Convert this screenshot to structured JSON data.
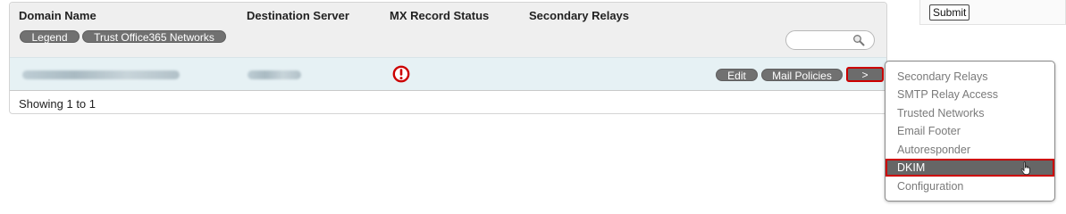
{
  "table": {
    "columns": [
      "Domain Name",
      "Destination Server",
      "MX Record Status",
      "Secondary Relays"
    ],
    "buttons": {
      "legend": "Legend",
      "trust_office365": "Trust Office365 Networks"
    },
    "search": {
      "value": "",
      "placeholder": ""
    },
    "row": {
      "domain": "",
      "destination": "",
      "mx_status_icon": "warning-circle-icon",
      "secondary_relays": "",
      "edit_label": "Edit",
      "mail_policies_label": "Mail Policies",
      "expand_label": ">"
    },
    "footer": "Showing 1 to 1"
  },
  "top_right": {
    "submit_label": "Submit"
  },
  "menu": {
    "items": [
      "Secondary Relays",
      "SMTP Relay Access",
      "Trusted Networks",
      "Email Footer",
      "Autoresponder",
      "DKIM",
      "Configuration"
    ],
    "active_item": "DKIM"
  },
  "colors": {
    "header_bg": "#efefef",
    "row_bg": "#e6f1f4",
    "pill_bg": "#717171",
    "highlight_border": "#cc0000",
    "warning": "#cc0000"
  }
}
